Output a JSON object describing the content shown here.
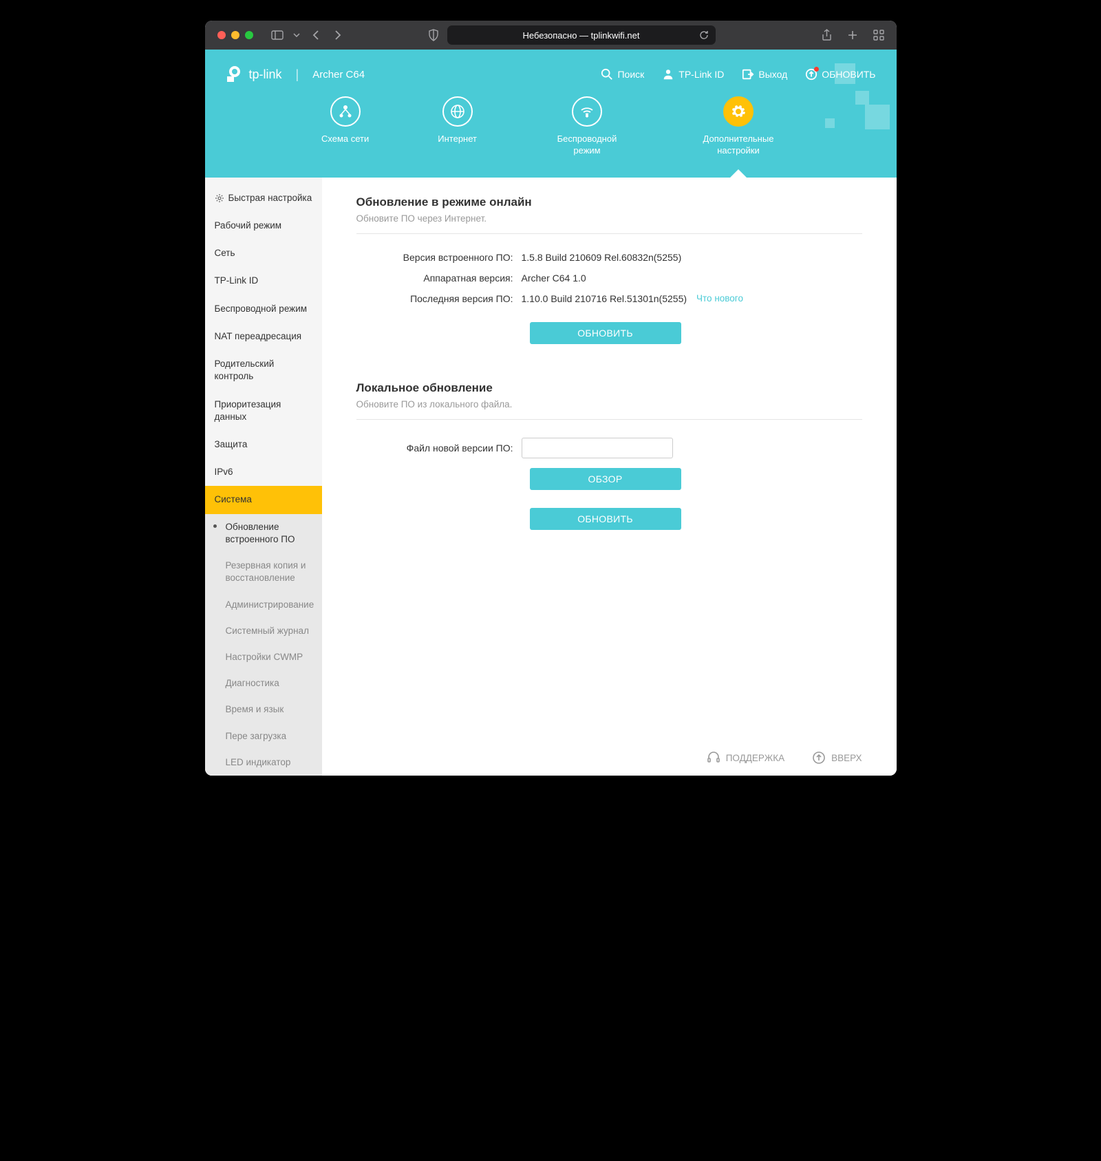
{
  "browser": {
    "address": "Небезопасно — tplinkwifi.net"
  },
  "header": {
    "brand": "tp-link",
    "model": "Archer C64",
    "actions": {
      "search": "Поиск",
      "tplink_id": "TP-Link ID",
      "logout": "Выход",
      "update": "ОБНОВИТЬ"
    },
    "nav": {
      "map": "Схема сети",
      "internet": "Интернет",
      "wireless": "Беспроводной режим",
      "advanced": "Дополнительные настройки"
    }
  },
  "sidebar": {
    "quick_setup": "Быстрая настройка",
    "items": [
      "Рабочий режим",
      "Сеть",
      "TP-Link ID",
      "Беспроводной режим",
      "NAT переадресация",
      "Родительский контроль",
      "Приоритезация данных",
      "Защита",
      "IPv6",
      "Система"
    ],
    "sub": [
      "Обновление встроенного ПО",
      "Резервная копия и восстановление",
      "Администрирование",
      "Системный журнал",
      "Настройки CWMP",
      "Диагностика",
      "Время и язык",
      "Пере загрузка",
      "LED индикатор"
    ]
  },
  "online": {
    "title": "Обновление в режиме онлайн",
    "desc": "Обновите ПО через Интернет.",
    "fw_label": "Версия встроенного ПО:",
    "fw_value": "1.5.8 Build 210609 Rel.60832n(5255)",
    "hw_label": "Аппаратная версия:",
    "hw_value": "Archer C64 1.0",
    "latest_label": "Последняя версия ПО:",
    "latest_value": "1.10.0 Build 210716 Rel.51301n(5255)",
    "whatsnew": "Что нового",
    "update_btn": "ОБНОВИТЬ"
  },
  "local": {
    "title": "Локальное обновление",
    "desc": "Обновите ПО из локального файла.",
    "file_label": "Файл новой версии ПО:",
    "browse_btn": "ОБЗОР",
    "update_btn": "ОБНОВИТЬ"
  },
  "footer": {
    "support": "ПОДДЕРЖКА",
    "top": "ВВЕРХ"
  }
}
